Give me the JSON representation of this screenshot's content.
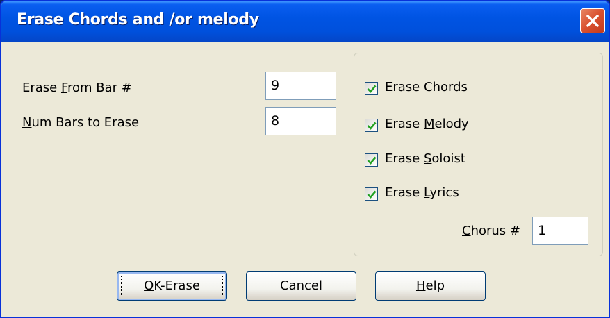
{
  "window": {
    "title": "Erase Chords and /or melody",
    "close_icon": "close-icon"
  },
  "fields": {
    "from_bar": {
      "label_pre": "Erase ",
      "label_key": "F",
      "label_post": "rom Bar #",
      "value": "9"
    },
    "num_bars": {
      "label_pre": "",
      "label_key": "N",
      "label_post": "um Bars to Erase",
      "value": "8"
    }
  },
  "options": {
    "chords": {
      "label_pre": "Erase ",
      "label_key": "C",
      "label_post": "hords",
      "checked": true
    },
    "melody": {
      "label_pre": "Erase ",
      "label_key": "M",
      "label_post": "elody",
      "checked": true
    },
    "soloist": {
      "label_pre": "Erase ",
      "label_key": "S",
      "label_post": "oloist",
      "checked": true
    },
    "lyrics": {
      "label_pre": "Erase ",
      "label_key": "L",
      "label_post": "yrics",
      "checked": true
    },
    "chorus": {
      "label_pre": "",
      "label_key": "C",
      "label_post": "horus #",
      "value": "1"
    }
  },
  "buttons": {
    "ok": {
      "label_key": "O",
      "label_post": "K-Erase"
    },
    "cancel": {
      "label": "Cancel"
    },
    "help": {
      "label_key": "H",
      "label_post": "elp"
    }
  },
  "colors": {
    "titlebar": "#0054e3",
    "dialog_bg": "#ece9d8",
    "checkmark": "#21a121",
    "close_button": "#d9502f"
  }
}
